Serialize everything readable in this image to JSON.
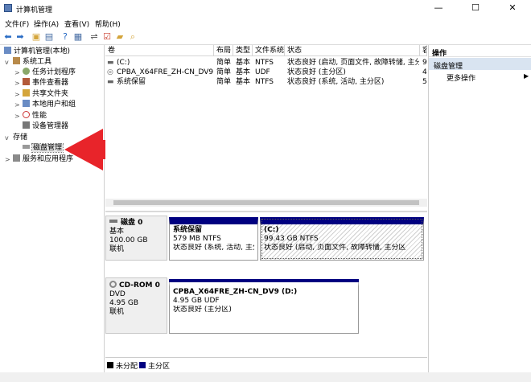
{
  "window": {
    "title": "计算机管理",
    "minimize_glyph": "—",
    "maximize_glyph": "☐",
    "close_glyph": "✕"
  },
  "menu": [
    "文件(F)",
    "操作(A)",
    "查看(V)",
    "帮助(H)"
  ],
  "toolbar": {
    "icons": [
      "back-arrow-icon",
      "forward-arrow-icon",
      "up-folder-icon",
      "show-hide-tree-icon",
      "help-icon",
      "properties-icon",
      "connect-icon",
      "check-icon",
      "folder-icon",
      "search-icon"
    ]
  },
  "tree": {
    "root": "计算机管理(本地)",
    "system_tools": "系统工具",
    "task_scheduler": "任务计划程序",
    "event_viewer": "事件查看器",
    "shared_folders": "共享文件夹",
    "local_users": "本地用户和组",
    "performance": "性能",
    "device_manager": "设备管理器",
    "storage": "存储",
    "disk_management": "磁盘管理",
    "services_apps": "服务和应用程序"
  },
  "volume_list": {
    "columns": [
      "卷",
      "布局",
      "类型",
      "文件系统",
      "状态",
      "容"
    ],
    "rows": [
      {
        "vol": "(C:)",
        "layout": "简单",
        "type": "基本",
        "fs": "NTFS",
        "status": "状态良好 (启动, 页面文件, 故障转储, 主分区)",
        "cap": "9"
      },
      {
        "vol": "CPBA_X64FRE_ZH-CN_DV9 (D:)",
        "layout": "简单",
        "type": "基本",
        "fs": "UDF",
        "status": "状态良好 (主分区)",
        "cap": "4"
      },
      {
        "vol": "系统保留",
        "layout": "简单",
        "type": "基本",
        "fs": "NTFS",
        "status": "状态良好 (系统, 活动, 主分区)",
        "cap": "5"
      }
    ]
  },
  "disks": [
    {
      "name": "磁盘 0",
      "kind": "基本",
      "size": "100.00 GB",
      "state": "联机",
      "partitions": [
        {
          "name": "系统保留",
          "size": "579 MB NTFS",
          "status": "状态良好 (系统, 活动, 主分区"
        },
        {
          "name": "(C:)",
          "size": "99.43 GB NTFS",
          "status": "状态良好 (启动, 页面文件, 故障转储, 主分区"
        }
      ]
    },
    {
      "name": "CD-ROM 0",
      "kind": "DVD",
      "size": "4.95 GB",
      "state": "联机",
      "partitions": [
        {
          "name": "CPBA_X64FRE_ZH-CN_DV9  (D:)",
          "size": "4.95 GB UDF",
          "status": "状态良好 (主分区)"
        }
      ]
    }
  ],
  "legend": [
    {
      "label": "未分配",
      "color": "#000000"
    },
    {
      "label": "主分区",
      "color": "#000080"
    }
  ],
  "actions": {
    "title": "操作",
    "section": "磁盘管理",
    "more": "更多操作",
    "more_arrow": "▶"
  },
  "colors": {
    "partition_header": "#000080",
    "arrow": "#e8242a",
    "action_section_bg": "#d9e4f1"
  }
}
